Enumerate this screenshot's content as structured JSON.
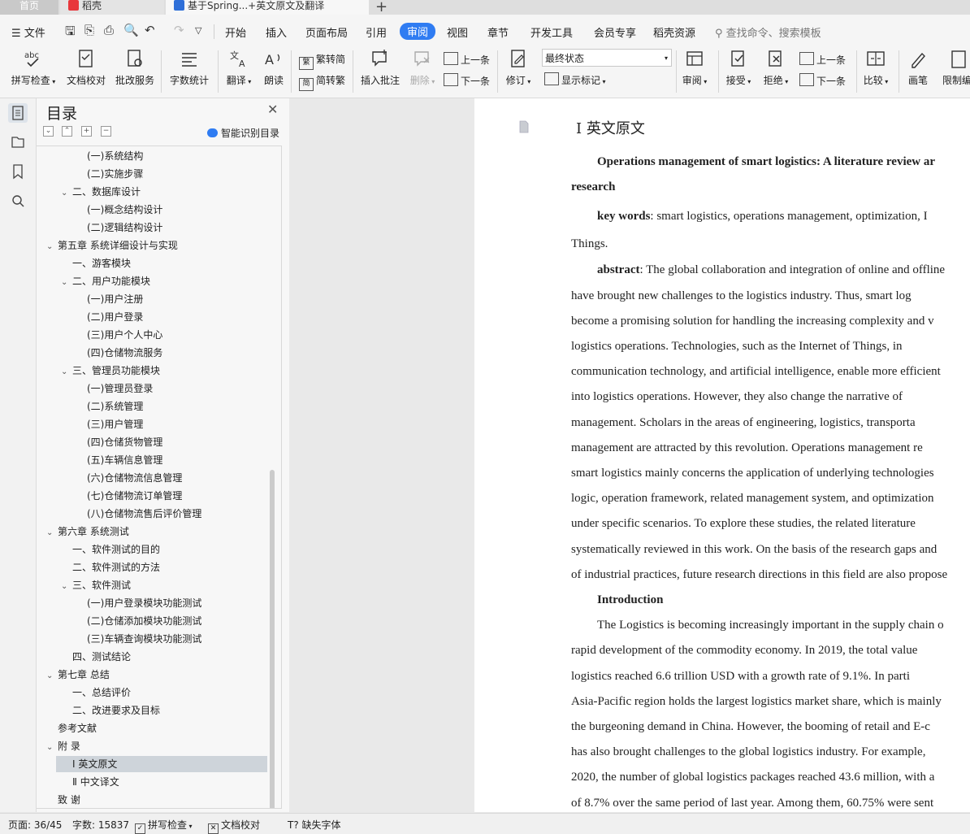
{
  "tabs": {
    "home": "首页",
    "docer": "稻壳",
    "doc": "基于Spring...+英文原文及翻译"
  },
  "menu": {
    "file": "文件",
    "items": [
      "开始",
      "插入",
      "页面布局",
      "引用",
      "审阅",
      "视图",
      "章节",
      "开发工具",
      "会员专享",
      "稻壳资源"
    ],
    "active": "审阅",
    "search_placeholder": "查找命令、搜索模板"
  },
  "ribbon": {
    "spell_check": "拼写检查",
    "doc_proof": "文档校对",
    "batch_service": "批改服务",
    "word_count": "字数统计",
    "translate": "翻译",
    "read_aloud": "朗读",
    "trad_simp": "繁转简",
    "simp_trad": "简转繁",
    "insert_comment": "插入批注",
    "delete": "删除",
    "prev_comment": "上一条",
    "next_comment": "下一条",
    "track_changes": "修订",
    "status_select": "最终状态",
    "show_marks": "显示标记",
    "review": "审阅",
    "accept": "接受",
    "reject": "拒绝",
    "prev_change": "上一条",
    "next_change": "下一条",
    "compare": "比较",
    "ink": "画笔",
    "restrict": "限制编"
  },
  "toc": {
    "title": "目录",
    "smart_label": "智能识别目录",
    "items": [
      {
        "text": "(一)系统结构",
        "level": 3,
        "chev": ""
      },
      {
        "text": "(二)实施步骤",
        "level": 3,
        "chev": ""
      },
      {
        "text": "二、数据库设计",
        "level": 2,
        "chev": "v"
      },
      {
        "text": "(一)概念结构设计",
        "level": 3,
        "chev": ""
      },
      {
        "text": "(二)逻辑结构设计",
        "level": 3,
        "chev": ""
      },
      {
        "text": "第五章  系统详细设计与实现",
        "level": 1,
        "chev": "v"
      },
      {
        "text": "一、游客模块",
        "level": 2,
        "chev": ""
      },
      {
        "text": "二、用户功能模块",
        "level": 2,
        "chev": "v"
      },
      {
        "text": "(一)用户注册",
        "level": 3,
        "chev": ""
      },
      {
        "text": "(二)用户登录",
        "level": 3,
        "chev": ""
      },
      {
        "text": "(三)用户个人中心",
        "level": 3,
        "chev": ""
      },
      {
        "text": "(四)仓储物流服务",
        "level": 3,
        "chev": ""
      },
      {
        "text": "三、管理员功能模块",
        "level": 2,
        "chev": "v"
      },
      {
        "text": "(一)管理员登录",
        "level": 3,
        "chev": ""
      },
      {
        "text": "(二)系统管理",
        "level": 3,
        "chev": ""
      },
      {
        "text": "(三)用户管理",
        "level": 3,
        "chev": ""
      },
      {
        "text": "(四)仓储货物管理",
        "level": 3,
        "chev": ""
      },
      {
        "text": "(五)车辆信息管理",
        "level": 3,
        "chev": ""
      },
      {
        "text": "(六)仓储物流信息管理",
        "level": 3,
        "chev": ""
      },
      {
        "text": "(七)仓储物流订单管理",
        "level": 3,
        "chev": ""
      },
      {
        "text": "(八)仓储物流售后评价管理",
        "level": 3,
        "chev": ""
      },
      {
        "text": "第六章  系统测试",
        "level": 1,
        "chev": "v"
      },
      {
        "text": "一、软件测试的目的",
        "level": 2,
        "chev": ""
      },
      {
        "text": "二、软件测试的方法",
        "level": 2,
        "chev": ""
      },
      {
        "text": "三、软件测试",
        "level": 2,
        "chev": "v"
      },
      {
        "text": "(一)用户登录模块功能测试",
        "level": 3,
        "chev": ""
      },
      {
        "text": "(二)仓储添加模块功能测试",
        "level": 3,
        "chev": ""
      },
      {
        "text": "(三)车辆查询模块功能测试",
        "level": 3,
        "chev": ""
      },
      {
        "text": "四、测试结论",
        "level": 2,
        "chev": ""
      },
      {
        "text": "第七章  总结",
        "level": 1,
        "chev": "v"
      },
      {
        "text": "一、总结评价",
        "level": 2,
        "chev": ""
      },
      {
        "text": "二、改进要求及目标",
        "level": 2,
        "chev": ""
      },
      {
        "text": "参考文献",
        "level": 1,
        "chev": ""
      },
      {
        "text": "附   录",
        "level": 1,
        "chev": "v"
      },
      {
        "text": "Ⅰ  英文原文",
        "level": 2,
        "chev": "",
        "selected": true
      },
      {
        "text": "Ⅱ  中文译文",
        "level": 2,
        "chev": ""
      },
      {
        "text": "致   谢",
        "level": 1,
        "chev": ""
      }
    ]
  },
  "document": {
    "heading": "Ⅰ  英文原文",
    "lines": [
      {
        "indent": true,
        "parts": [
          {
            "b": true,
            "t": "Operations management of smart logistics: A literature review ar"
          }
        ]
      },
      {
        "indent": false,
        "parts": [
          {
            "b": true,
            "t": "research"
          }
        ]
      },
      {
        "indent": true,
        "parts": [
          {
            "b": true,
            "t": " key words"
          },
          {
            "b": false,
            "t": ":   smart logistics, operations management, optimization, I"
          }
        ]
      },
      {
        "indent": false,
        "parts": [
          {
            "b": false,
            "t": "Things."
          }
        ]
      },
      {
        "indent": true,
        "parts": [
          {
            "b": true,
            "t": "abstract"
          },
          {
            "b": false,
            "t": ": The global collaboration and integration of online and offline"
          }
        ]
      },
      {
        "indent": false,
        "parts": [
          {
            "b": false,
            "t": "have brought new challenges to the logistics industry. Thus, smart log"
          }
        ]
      },
      {
        "indent": false,
        "parts": [
          {
            "b": false,
            "t": "become a promising solution for handling the increasing complexity and v"
          }
        ]
      },
      {
        "indent": false,
        "parts": [
          {
            "b": false,
            "t": "logistics operations. Technologies, such as the Internet of Things, in"
          }
        ]
      },
      {
        "indent": false,
        "parts": [
          {
            "b": false,
            "t": "communication technology, and artificial intelligence, enable more efficient"
          }
        ]
      },
      {
        "indent": false,
        "parts": [
          {
            "b": false,
            "t": "into logistics operations. However, they also change the narrative of"
          }
        ]
      },
      {
        "indent": false,
        "parts": [
          {
            "b": false,
            "t": "management. Scholars in the areas of engineering, logistics, transporta"
          }
        ]
      },
      {
        "indent": false,
        "parts": [
          {
            "b": false,
            "t": "management are attracted by this revolution. Operations management re"
          }
        ]
      },
      {
        "indent": false,
        "parts": [
          {
            "b": false,
            "t": "smart logistics mainly concerns the application of underlying technologies"
          }
        ]
      },
      {
        "indent": false,
        "parts": [
          {
            "b": false,
            "t": "logic, operation framework, related management system, and optimization"
          }
        ]
      },
      {
        "indent": false,
        "parts": [
          {
            "b": false,
            "t": "under specific scenarios. To explore these studies, the related literature"
          }
        ]
      },
      {
        "indent": false,
        "parts": [
          {
            "b": false,
            "t": "systematically reviewed in this work. On the basis of the research gaps and"
          }
        ]
      },
      {
        "indent": false,
        "parts": [
          {
            "b": false,
            "t": "of industrial practices, future research directions in this field are also propose"
          }
        ]
      },
      {
        "indent": true,
        "parts": [
          {
            "b": true,
            "t": "Introduction"
          }
        ]
      },
      {
        "indent": true,
        "parts": [
          {
            "b": false,
            "t": "The Logistics is becoming increasingly important in the supply chain o"
          }
        ]
      },
      {
        "indent": false,
        "parts": [
          {
            "b": false,
            "t": "rapid development of the commodity economy. In 2019, the total value"
          }
        ]
      },
      {
        "indent": false,
        "parts": [
          {
            "b": false,
            "t": "logistics reached 6.6 trillion USD with a growth rate of 9.1%. In parti"
          }
        ]
      },
      {
        "indent": false,
        "parts": [
          {
            "b": false,
            "t": "Asia-Pacific region holds the largest logistics market share, which is mainly"
          }
        ]
      },
      {
        "indent": false,
        "parts": [
          {
            "b": false,
            "t": "the burgeoning demand in China. However, the booming of retail and E-c"
          }
        ]
      },
      {
        "indent": false,
        "parts": [
          {
            "b": false,
            "t": "has also brought challenges to the global logistics industry. For example,"
          }
        ]
      },
      {
        "indent": false,
        "parts": [
          {
            "b": false,
            "t": "2020, the number of global logistics packages reached 43.6 million, with a"
          }
        ]
      },
      {
        "indent": false,
        "parts": [
          {
            "b": false,
            "t": "of 8.7% over the same period of last year. Among them, 60.75% were sent"
          }
        ]
      }
    ]
  },
  "status": {
    "page": "页面: 36/45",
    "words": "字数: 15837",
    "spell": "拼写检查",
    "proof": "文档校对",
    "missing_font": "缺失字体"
  }
}
